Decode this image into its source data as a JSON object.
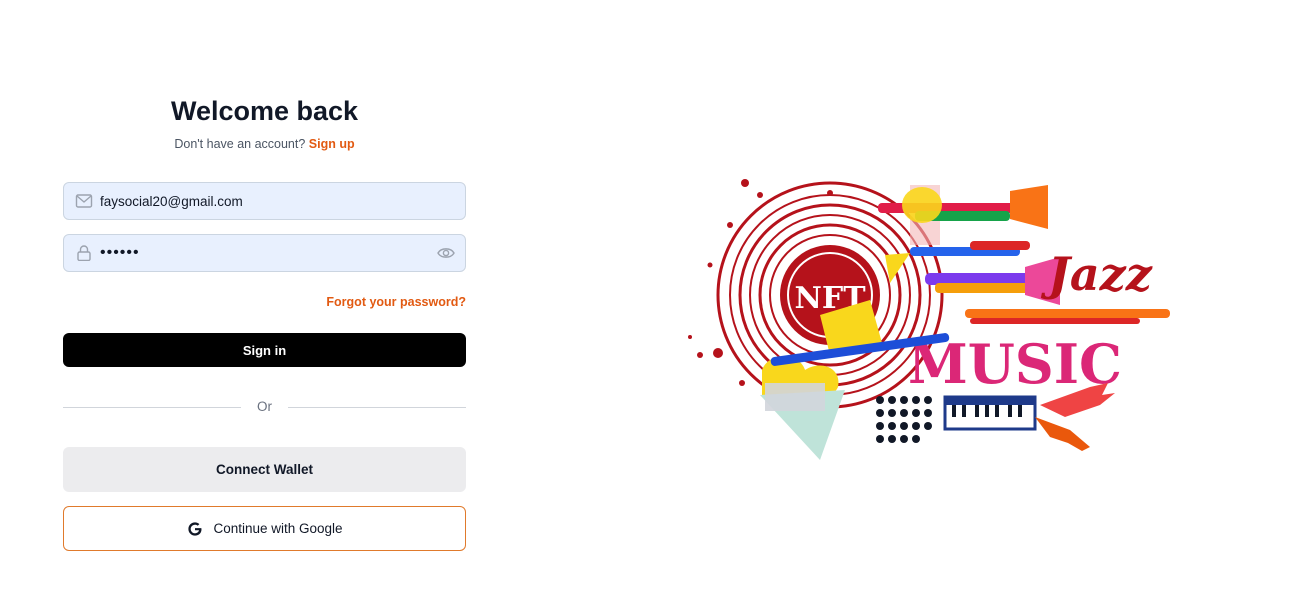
{
  "header": {
    "title": "Welcome back",
    "subtitle_prefix": "Don't have an account?",
    "signup_link": "Sign up"
  },
  "form": {
    "email_value": "faysocial20@gmail.com",
    "password_value": "••••••",
    "forgot_link": "Forgot your password?",
    "signin_label": "Sign in"
  },
  "divider": {
    "label": "Or"
  },
  "alt_auth": {
    "wallet_label": "Connect Wallet",
    "google_label": "Continue with Google"
  },
  "artwork": {
    "nft_text": "NFT",
    "jazz_text": "Jazz",
    "music_text": "MUSIC"
  },
  "icons": {
    "email": "mail-icon",
    "password": "lock-icon",
    "reveal": "eye-icon",
    "google": "google-icon"
  },
  "colors": {
    "accent": "#e25a12",
    "primary_button": "#000000",
    "input_bg": "#e8f0fe",
    "google_border": "#e07a2c"
  }
}
